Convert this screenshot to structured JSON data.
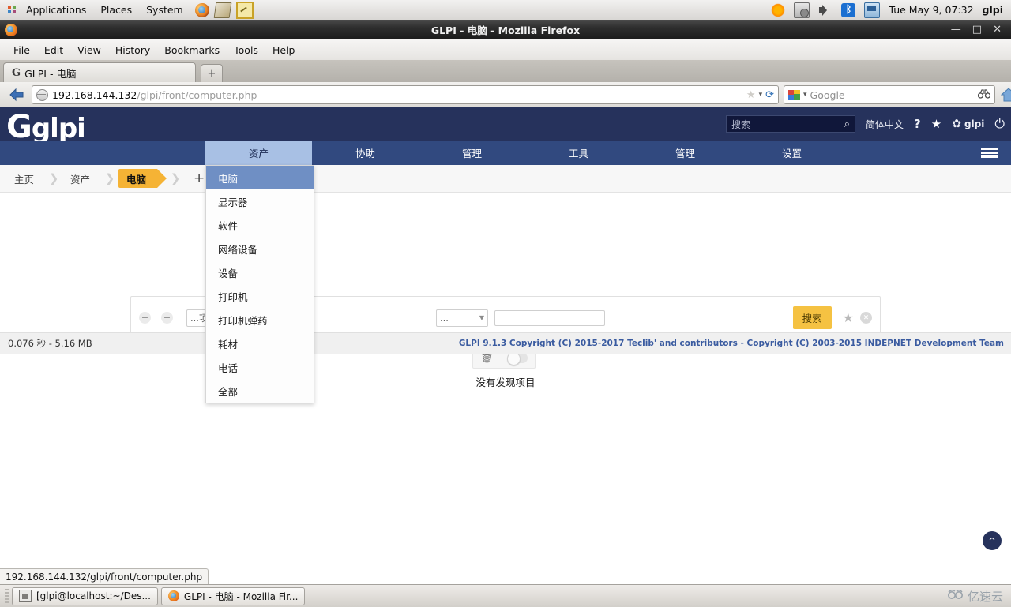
{
  "desktop": {
    "applications_label": "Applications",
    "places_label": "Places",
    "system_label": "System",
    "clock": "Tue May  9, 07:32",
    "user": "glpi",
    "launchers": [
      "firefox-icon",
      "dictionary-icon",
      "notes-icon"
    ],
    "tray": [
      "sun-icon",
      "update-manager-icon",
      "volume-icon",
      "bluetooth-icon",
      "network-icon"
    ]
  },
  "browser": {
    "window_title": "GLPI - 电脑 - Mozilla Firefox",
    "window_buttons": {
      "minimize": "—",
      "maximize": "□",
      "close": "✕"
    },
    "menus": [
      "File",
      "Edit",
      "View",
      "History",
      "Bookmarks",
      "Tools",
      "Help"
    ],
    "tab": {
      "title": "GLPI - 电脑",
      "favicon": "G"
    },
    "new_tab_label": "+",
    "url_host": "192.168.144.132",
    "url_path": "/glpi/front/computer.php",
    "search_placeholder": "Google",
    "search_engine": "google-icon"
  },
  "glpi": {
    "search_placeholder": "搜索",
    "language": "简体中文",
    "help_label": "?",
    "favorite_label": "★",
    "user_label": "glpi",
    "logo": "glpi",
    "nav": [
      {
        "label": "资产",
        "active": true
      },
      {
        "label": "协助",
        "active": false
      },
      {
        "label": "管理",
        "active": false
      },
      {
        "label": "工具",
        "active": false
      },
      {
        "label": "管理",
        "active": false
      },
      {
        "label": "设置",
        "active": false
      }
    ],
    "dropdown": [
      {
        "label": "电脑",
        "selected": true
      },
      {
        "label": "显示器",
        "selected": false
      },
      {
        "label": "软件",
        "selected": false
      },
      {
        "label": "网络设备",
        "selected": false
      },
      {
        "label": "设备",
        "selected": false
      },
      {
        "label": "打印机",
        "selected": false
      },
      {
        "label": "打印机弹药",
        "selected": false
      },
      {
        "label": "耗材",
        "selected": false
      },
      {
        "label": "电话",
        "selected": false
      },
      {
        "label": "全部",
        "selected": false
      }
    ],
    "breadcrumb": [
      {
        "label": "主页",
        "current": false
      },
      {
        "label": "资产",
        "current": false
      },
      {
        "label": "电脑",
        "current": true
      }
    ],
    "breadcrumb_actions": [
      "plus-icon",
      "search-icon"
    ],
    "search_panel": {
      "add_button": "+",
      "add_group_button": "+",
      "field_select": "...项目",
      "operator_select": "...",
      "value_input": "",
      "search_button": "搜索",
      "save_icon": "star-icon",
      "reset_icon": "close-icon"
    },
    "mass_actions": {
      "delete_icon": "trash-icon",
      "toggle": "off"
    },
    "empty_message": "没有发现项目",
    "footer_left": "0.076 秒 - 5.16 MB",
    "footer_right": "GLPI 9.1.3 Copyright (C) 2015-2017 Teclib' and contributors - Copyright (C) 2003-2015 INDEPNET Development Team",
    "scroll_top": "^"
  },
  "statusbar": {
    "link": "192.168.144.132/glpi/front/computer.php"
  },
  "taskbar": {
    "items": [
      {
        "label": "[glpi@localhost:~/Des...",
        "icon": "terminal-icon"
      },
      {
        "label": "GLPI - 电脑 - Mozilla Fir...",
        "icon": "firefox-icon"
      }
    ],
    "watermark": "亿速云"
  }
}
